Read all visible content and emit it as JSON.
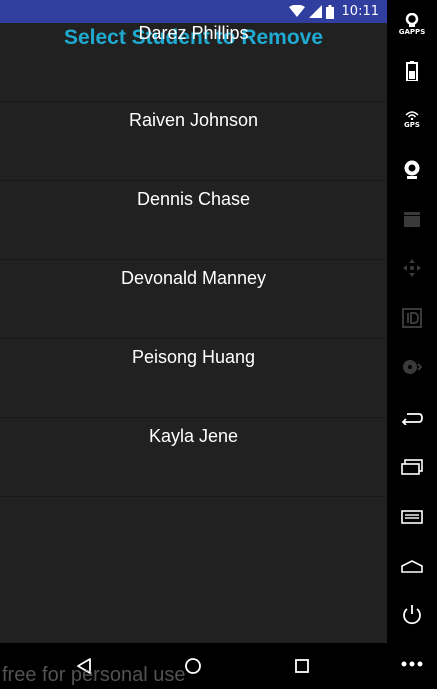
{
  "status_bar": {
    "time": "10:11",
    "icons": [
      "wifi-icon",
      "signal-icon",
      "battery-icon"
    ]
  },
  "page": {
    "title": "Select Student to Remove"
  },
  "students": [
    {
      "name": "Darez Phillips"
    },
    {
      "name": "Raiven Johnson"
    },
    {
      "name": "Dennis Chase"
    },
    {
      "name": "Devonald Manney"
    },
    {
      "name": "Peisong Huang"
    },
    {
      "name": "Kayla Jene"
    }
  ],
  "nav_bar": {
    "buttons": [
      "back-icon",
      "home-icon",
      "recents-icon"
    ]
  },
  "watermark": "free for personal use",
  "emulator_toolbar": {
    "items": [
      {
        "icon": "gapps-icon",
        "label": "GAPPS"
      },
      {
        "icon": "battery-icon",
        "label": ""
      },
      {
        "icon": "gps-icon",
        "label": "GPS"
      },
      {
        "icon": "webcam-icon",
        "label": ""
      },
      {
        "icon": "clapper-icon",
        "label": ""
      },
      {
        "icon": "dpad-icon",
        "label": ""
      },
      {
        "icon": "id-icon",
        "label": ""
      },
      {
        "icon": "disk-icon",
        "label": ""
      },
      {
        "icon": "back-icon",
        "label": ""
      },
      {
        "icon": "recents-icon",
        "label": ""
      },
      {
        "icon": "menu-icon",
        "label": ""
      },
      {
        "icon": "home-icon",
        "label": ""
      },
      {
        "icon": "power-icon",
        "label": ""
      },
      {
        "icon": "more-icon",
        "label": ""
      }
    ]
  },
  "colors": {
    "status_bar": "#303f9f",
    "title": "#1eaad1",
    "background": "#212121"
  }
}
